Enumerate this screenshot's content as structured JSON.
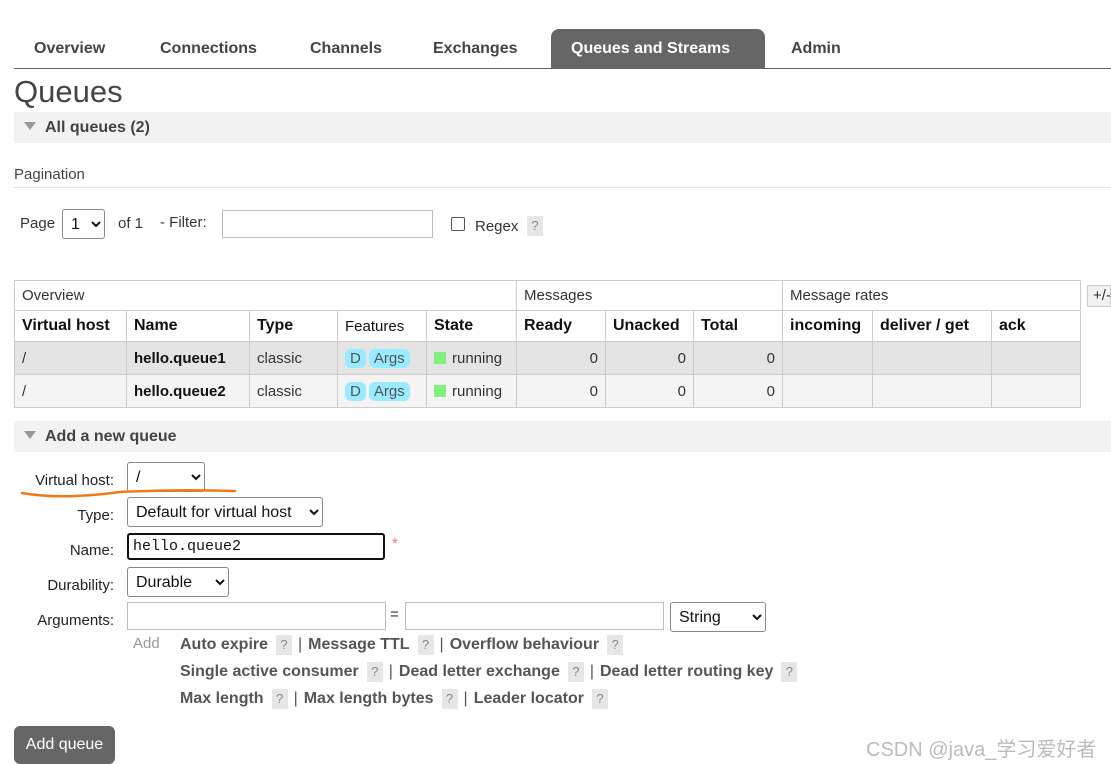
{
  "nav": {
    "tabs": [
      {
        "label": "Overview"
      },
      {
        "label": "Connections"
      },
      {
        "label": "Channels"
      },
      {
        "label": "Exchanges"
      },
      {
        "label": "Queues and Streams",
        "active": true
      },
      {
        "label": "Admin"
      }
    ]
  },
  "page": {
    "title": "Queues"
  },
  "all_queues": {
    "label": "All queues (2)"
  },
  "pagination": {
    "title": "Pagination",
    "page_label": "Page",
    "page_value": "1",
    "of_label": "of 1",
    "filter_label": "- Filter:",
    "filter_value": "",
    "regex_label": "Regex",
    "help": "?"
  },
  "table": {
    "group_headers": {
      "overview": "Overview",
      "messages": "Messages",
      "rates": "Message rates"
    },
    "plus_minus": "+/-",
    "columns": [
      "Virtual host",
      "Name",
      "Type",
      "Features",
      "State",
      "Ready",
      "Unacked",
      "Total",
      "incoming",
      "deliver / get",
      "ack"
    ],
    "rows": [
      {
        "vhost": "/",
        "name": "hello.queue1",
        "type": "classic",
        "feature_d": "D",
        "feature_args": "Args",
        "state": "running",
        "ready": "0",
        "unacked": "0",
        "total": "0",
        "incoming": "",
        "deliver_get": "",
        "ack": ""
      },
      {
        "vhost": "/",
        "name": "hello.queue2",
        "type": "classic",
        "feature_d": "D",
        "feature_args": "Args",
        "state": "running",
        "ready": "0",
        "unacked": "0",
        "total": "0",
        "incoming": "",
        "deliver_get": "",
        "ack": ""
      }
    ]
  },
  "add_queue": {
    "section_label": "Add a new queue",
    "vhost_label": "Virtual host:",
    "vhost_value": "/",
    "type_label": "Type:",
    "type_value": "Default for virtual host",
    "name_label": "Name:",
    "name_value": "hello.queue2",
    "required_mark": "*",
    "durability_label": "Durability:",
    "durability_value": "Durable",
    "arguments_label": "Arguments:",
    "arg_key": "",
    "arg_equals": "=",
    "arg_value": "",
    "arg_type": "String",
    "add_link": "Add",
    "hints": {
      "auto_expire": "Auto expire",
      "message_ttl": "Message TTL",
      "overflow": "Overflow behaviour",
      "single_active": "Single active consumer",
      "dlx": "Dead letter exchange",
      "dlrk": "Dead letter routing key",
      "max_length": "Max length",
      "max_length_bytes": "Max length bytes",
      "leader_locator": "Leader locator",
      "separator": "|",
      "help": "?"
    },
    "submit_label": "Add queue"
  },
  "watermark": "CSDN @java_学习爱好者",
  "colors": {
    "tab_active": "#666666",
    "running": "#80f080",
    "feature_tag": "#99ebff",
    "annotation": "#f07a1a"
  }
}
